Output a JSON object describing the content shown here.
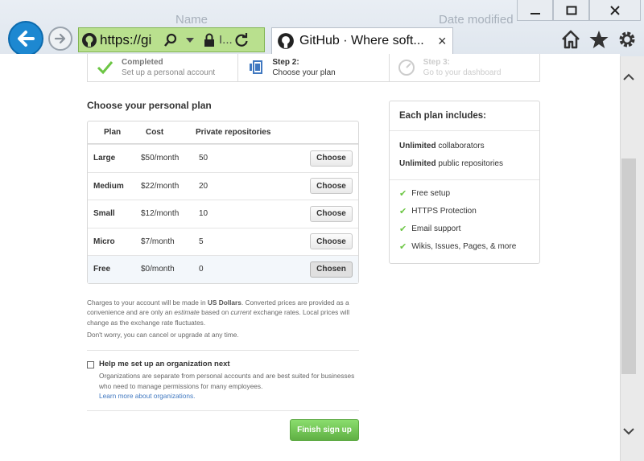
{
  "browser": {
    "bg_column_name": "Name",
    "bg_column_date": "Date modified",
    "address": "https://gi",
    "address_org": "I...",
    "tab_title": "GitHub · Where soft...",
    "tab_close": "×",
    "icons": [
      "back-icon",
      "forward-icon",
      "github-icon",
      "search-icon",
      "lock-icon",
      "refresh-icon",
      "home-icon",
      "star-icon",
      "gear-icon"
    ]
  },
  "steps": [
    {
      "name": "Completed",
      "desc": "Set up a personal account"
    },
    {
      "name": "Step 2:",
      "desc": "Choose your plan"
    },
    {
      "name": "Step 3:",
      "desc": "Go to your dashboard"
    }
  ],
  "plans": {
    "title": "Choose your personal plan",
    "headers": {
      "plan": "Plan",
      "cost": "Cost",
      "repos": "Private repositories"
    },
    "rows": [
      {
        "name": "Large",
        "cost": "$50/month",
        "repos": "50",
        "button": "Choose"
      },
      {
        "name": "Medium",
        "cost": "$22/month",
        "repos": "20",
        "button": "Choose"
      },
      {
        "name": "Small",
        "cost": "$12/month",
        "repos": "10",
        "button": "Choose"
      },
      {
        "name": "Micro",
        "cost": "$7/month",
        "repos": "5",
        "button": "Choose"
      },
      {
        "name": "Free",
        "cost": "$0/month",
        "repos": "0",
        "button": "Chosen"
      }
    ]
  },
  "note": {
    "p1": "Charges to your account will be made in",
    "currency": "US Dollars",
    "p2": ". Converted prices are provided as a convenience and are only an",
    "estimate": "estimate",
    "p3": "based on",
    "current": "current",
    "p4": "exchange rates. Local prices will change as the exchange rate fluctuates.",
    "cancel": "Don't worry, you can cancel or upgrade at any time."
  },
  "org": {
    "title": "Help me set up an organization next",
    "desc": "Organizations are separate from personal accounts and are best suited for businesses who need to manage permissions for many employees.",
    "link": "Learn more about organizations."
  },
  "finish_label": "Finish sign up",
  "includes": {
    "title": "Each plan includes:",
    "unlimited_word": "Unlimited",
    "collaborators": "collaborators",
    "public_repos": "public repositories",
    "features": [
      "Free setup",
      "HTTPS Protection",
      "Email support",
      "Wikis, Issues, Pages, & more"
    ],
    "check_color": "#6cc644"
  },
  "colors": {
    "accent_green": "#60b044",
    "link_blue": "#4078c0",
    "ie_blue": "#1d88d1",
    "address_green": "#b9e08e"
  }
}
